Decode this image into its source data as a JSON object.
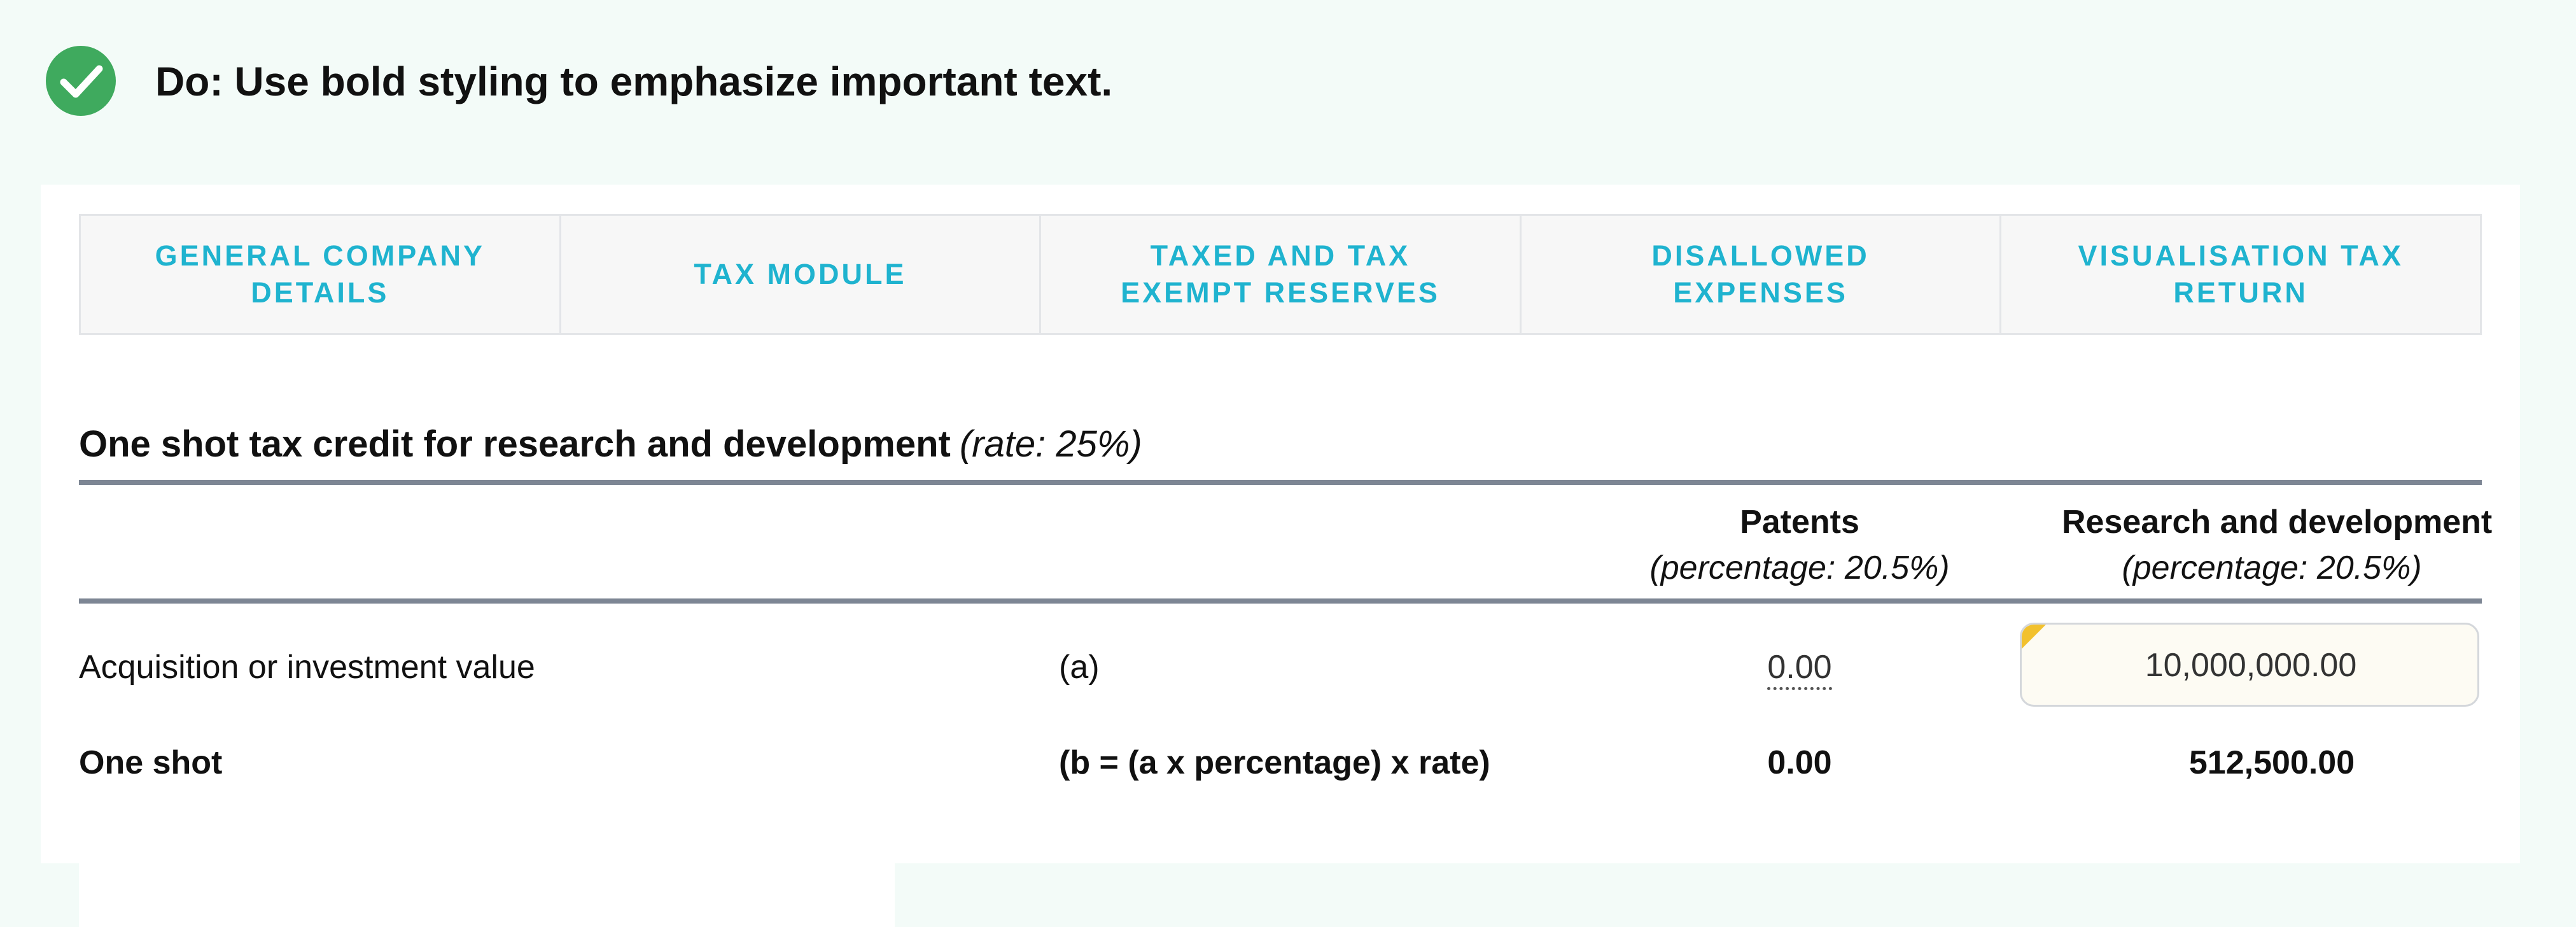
{
  "guideline": {
    "icon": "check-circle-icon",
    "icon_color": "#3faa5e",
    "text": "Do: Use bold styling to emphasize important text."
  },
  "tabs": [
    {
      "label": "GENERAL COMPANY DETAILS"
    },
    {
      "label": "TAX MODULE"
    },
    {
      "label": "TAXED AND TAX EXEMPT RESERVES"
    },
    {
      "label": "DISALLOWED EXPENSES"
    },
    {
      "label": "VISUALISATION TAX RETURN"
    }
  ],
  "tab_color": "#1fb3cf",
  "section": {
    "title": "One shot tax credit for research and development",
    "rate_note": "(rate: 25%)"
  },
  "columns": {
    "patents": {
      "name": "Patents",
      "percentage": "(percentage: 20.5%)"
    },
    "rd": {
      "name": "Research and development",
      "percentage": "(percentage: 20.5%)"
    }
  },
  "rows": [
    {
      "label": "Acquisition or investment value",
      "formula": "(a)",
      "patents": "0.00",
      "rd": "10,000,000.00"
    },
    {
      "label": "One shot",
      "formula": "(b = (a x percentage) x rate)",
      "patents": "0.00",
      "rd": "512,500.00"
    }
  ]
}
